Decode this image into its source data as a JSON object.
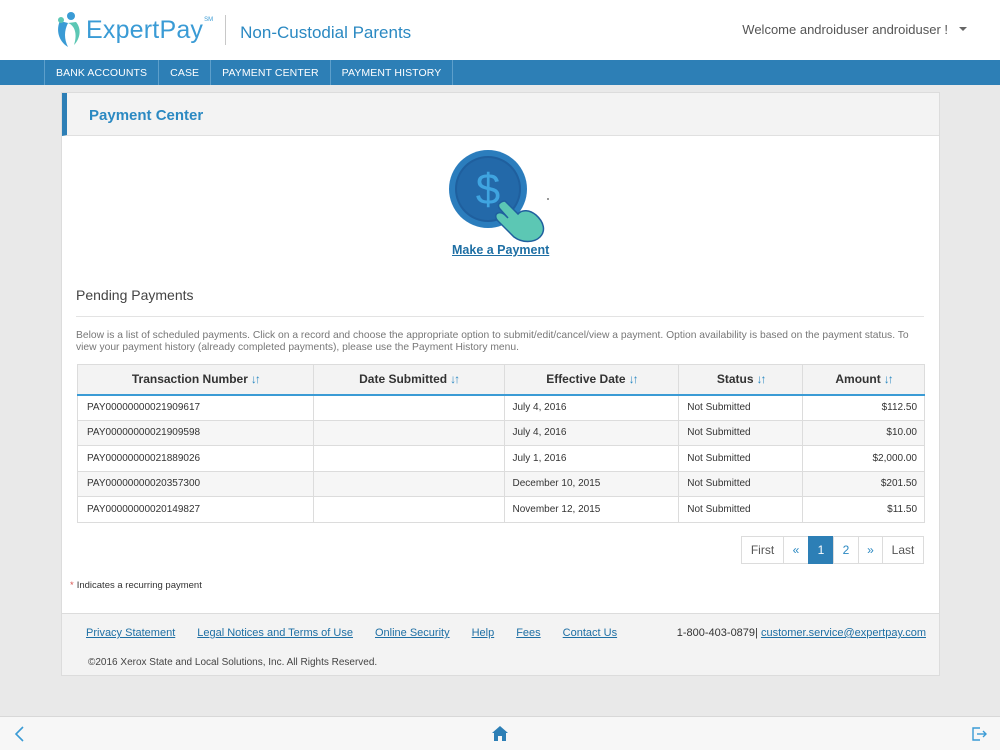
{
  "header": {
    "brand": "ExpertPay",
    "brand_mark": "SM",
    "subtitle": "Non-Custodial Parents",
    "welcome": "Welcome androiduser androiduser !"
  },
  "nav": {
    "items": [
      "BANK ACCOUNTS",
      "CASE",
      "PAYMENT CENTER",
      "PAYMENT HISTORY"
    ]
  },
  "panel": {
    "title": "Payment Center",
    "make_payment": "Make a Payment"
  },
  "pending": {
    "title": "Pending Payments",
    "description": "Below is a list of scheduled payments. Click on a record and choose the appropriate option to submit/edit/cancel/view a payment. Option availability is based on the payment status. To view your payment history (already completed payments), please use the Payment History menu.",
    "columns": [
      "Transaction Number",
      "Date Submitted",
      "Effective Date",
      "Status",
      "Amount"
    ],
    "rows": [
      [
        "PAY00000000021909617",
        "",
        "July 4, 2016",
        "Not Submitted",
        "$112.50"
      ],
      [
        "PAY00000000021909598",
        "",
        "July 4, 2016",
        "Not Submitted",
        "$10.00"
      ],
      [
        "PAY00000000021889026",
        "",
        "July 1, 2016",
        "Not Submitted",
        "$2,000.00"
      ],
      [
        "PAY00000000020357300",
        "",
        "December 10, 2015",
        "Not Submitted",
        "$201.50"
      ],
      [
        "PAY00000000020149827",
        "",
        "November 12, 2015",
        "Not Submitted",
        "$11.50"
      ]
    ]
  },
  "pager": {
    "first": "First",
    "prev": "«",
    "pages": [
      "1",
      "2"
    ],
    "current_page": "1",
    "next": "»",
    "last": "Last"
  },
  "note": {
    "star": "*",
    "text": "Indicates a recurring payment"
  },
  "footer": {
    "links": [
      "Privacy Statement",
      "Legal Notices and Terms of Use",
      "Online Security",
      "Help",
      "Fees",
      "Contact Us"
    ],
    "phone": "1-800-403-0879|",
    "email": "customer.service@expertpay.com",
    "copyright": "©2016 Xerox State and Local Solutions, Inc. All Rights Reserved."
  },
  "bottom_bar": {
    "icons": [
      "back-arrow-icon",
      "home-icon",
      "logout-icon"
    ]
  },
  "colors": {
    "brand_blue": "#2d7fb6",
    "accent_blue": "#3a9bd5",
    "link_blue": "#1e6fa4",
    "teal_hand": "#5cc7b4"
  }
}
